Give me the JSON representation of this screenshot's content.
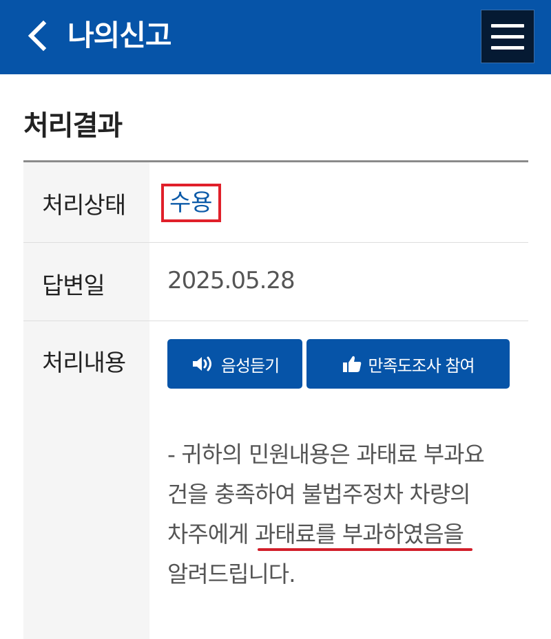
{
  "header": {
    "title": "나의신고",
    "back_icon": "chevron-left-icon",
    "menu_icon": "hamburger-menu-icon",
    "background": "#0654a8"
  },
  "section": {
    "title": "처리결과"
  },
  "rows": {
    "status": {
      "label": "처리상태",
      "value": "수용",
      "highlight_color": "#e0202a"
    },
    "date": {
      "label": "답변일",
      "value": "2025.05.28"
    },
    "content": {
      "label": "처리내용",
      "voice_button": {
        "label": "음성듣기",
        "icon": "speaker-icon"
      },
      "survey_button": {
        "label": "만족도조사 참여",
        "icon": "thumbs-up-icon"
      },
      "lines": [
        "- 귀하의 민원내용은 과태료 부과요",
        "건을 충족하여 불법주정차 차량의",
        "차주에게 과태료를 부과하였음을",
        "알려드립니다."
      ],
      "underline_color": "#d21e2a"
    }
  }
}
